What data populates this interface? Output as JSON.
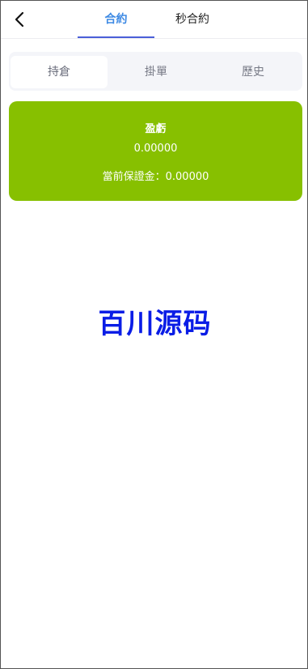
{
  "header": {
    "tabs": [
      {
        "label": "合約"
      },
      {
        "label": "秒合約"
      }
    ]
  },
  "segments": [
    {
      "label": "持倉"
    },
    {
      "label": "掛單"
    },
    {
      "label": "歷史"
    }
  ],
  "summary": {
    "pnl_label": "盈虧",
    "pnl_value": "0.00000",
    "margin_label": "當前保證金：",
    "margin_value": "0.00000"
  },
  "watermark": "百川源码",
  "colors": {
    "accent": "#3e8ae4",
    "underline": "#4b5fd8",
    "card": "#87c000",
    "watermark": "#0a1de6"
  },
  "icons": {
    "back": "chevron-left-icon"
  }
}
